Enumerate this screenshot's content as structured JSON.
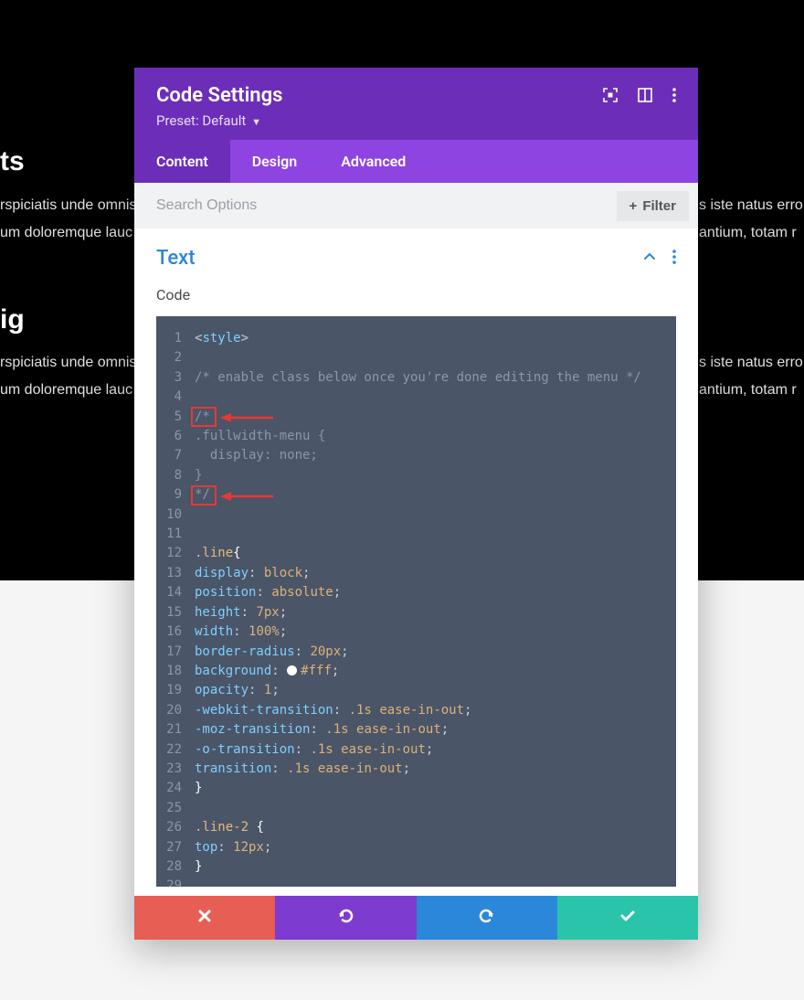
{
  "background": {
    "heading1": "ts",
    "para1a": "rspiciatis unde omnis",
    "para1a_right": "s iste natus erro",
    "para1b": "um doloremque lauc",
    "para1b_right": "antium, totam r",
    "heading2": "ig",
    "para2a": "rspiciatis unde omnis",
    "para2a_right": "s iste natus erro",
    "para2b": "um doloremque lauc",
    "para2b_right": "antium, totam r"
  },
  "modal": {
    "title": "Code Settings",
    "preset_label": "Preset:",
    "preset_value": "Default"
  },
  "tabs": {
    "content": "Content",
    "design": "Design",
    "advanced": "Advanced"
  },
  "search": {
    "placeholder": "Search Options",
    "filter_label": "Filter"
  },
  "section": {
    "title": "Text",
    "field_label": "Code"
  },
  "code": {
    "line_count": 29,
    "lines": {
      "1": {
        "open": "<",
        "tag": "style",
        "close": ">"
      },
      "3": {
        "comment": "/* enable class below once you're done editing the menu */"
      },
      "5": {
        "comment": "/*"
      },
      "6": {
        "sel": ".fullwidth-menu",
        "brace": " {"
      },
      "7": {
        "indent": "  ",
        "prop": "display",
        "colon": ": ",
        "val": "none",
        "semi": ";"
      },
      "8": {
        "brace": "}"
      },
      "9": {
        "comment": "*/"
      },
      "12": {
        "sel": ".line",
        "brace": "{"
      },
      "13": {
        "prop": "display",
        "colon": ": ",
        "val": "block",
        "semi": ";"
      },
      "14": {
        "prop": "position",
        "colon": ": ",
        "val": "absolute",
        "semi": ";"
      },
      "15": {
        "prop": "height",
        "colon": ": ",
        "val": "7px",
        "semi": ";"
      },
      "16": {
        "prop": "width",
        "colon": ": ",
        "val": "100%",
        "semi": ";"
      },
      "17": {
        "prop": "border-radius",
        "colon": ": ",
        "val": "20px",
        "semi": ";"
      },
      "18": {
        "prop": "background",
        "colon": ": ",
        "val": "#fff",
        "semi": ";"
      },
      "19": {
        "prop": "opacity",
        "colon": ": ",
        "val": "1",
        "semi": ";"
      },
      "20": {
        "prop": "-webkit-transition",
        "colon": ": ",
        "v1": ".1s",
        "v2": "ease-in-out",
        "semi": ";"
      },
      "21": {
        "prop": "-moz-transition",
        "colon": ": ",
        "v1": ".1s",
        "v2": "ease-in-out",
        "semi": ";"
      },
      "22": {
        "prop": "-o-transition",
        "colon": ": ",
        "v1": ".1s",
        "v2": "ease-in-out",
        "semi": ";"
      },
      "23": {
        "prop": "transition",
        "colon": ": ",
        "v1": ".1s",
        "v2": "ease-in-out",
        "semi": ";"
      },
      "24": {
        "brace": "}"
      },
      "26": {
        "sel": ".line-2",
        "brace": " {"
      },
      "27": {
        "prop": "top",
        "colon": ": ",
        "val": "12px",
        "semi": ";"
      },
      "28": {
        "brace": "}"
      }
    }
  }
}
